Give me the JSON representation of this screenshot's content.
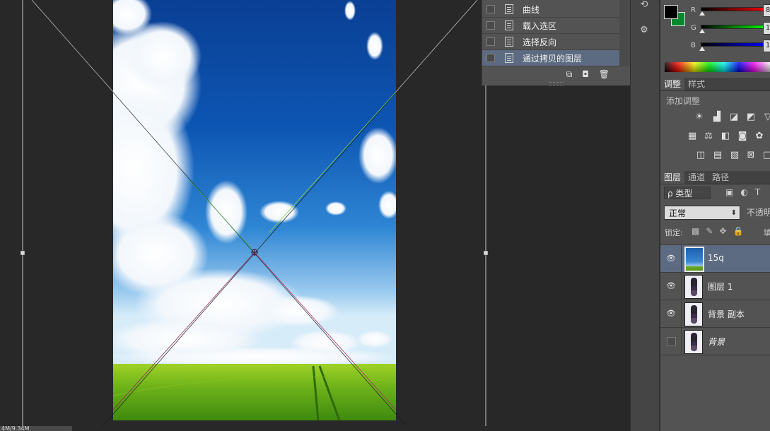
{
  "status_bar": {
    "doc_size": "4M/9.34M"
  },
  "history": {
    "items": [
      {
        "label": "曲线",
        "active": false
      },
      {
        "label": "载入选区",
        "active": false
      },
      {
        "label": "选择反向",
        "active": false
      },
      {
        "label": "通过拷贝的图层",
        "active": true
      }
    ],
    "bottom_icons": [
      "new-snapshot-icon",
      "camera-icon",
      "trash-icon"
    ]
  },
  "iconbar": {
    "buttons": [
      "history-panel-icon",
      "properties-panel-icon",
      "collapse-icon"
    ]
  },
  "color_panel": {
    "foreground": "#000000",
    "background": "#008a2d",
    "channels": [
      {
        "label": "R",
        "value": "8"
      },
      {
        "label": "G",
        "value": "1"
      },
      {
        "label": "B",
        "value": "1"
      }
    ]
  },
  "adjustments": {
    "tabs": [
      "调整",
      "样式"
    ],
    "title": "添加调整"
  },
  "layers_panel": {
    "tabs": [
      "图层",
      "通道",
      "路径"
    ],
    "filter_label": "ρ 类型",
    "blend_mode": "正常",
    "opacity_label": "不透明",
    "lock_label": "锁定:",
    "fill_label": "填",
    "layers": [
      {
        "name": "15q",
        "visible": true,
        "selected": true,
        "thumb": "sky"
      },
      {
        "name": "图层 1",
        "visible": true,
        "selected": false,
        "thumb": "person"
      },
      {
        "name": "背景 副本",
        "visible": true,
        "selected": false,
        "thumb": "person"
      },
      {
        "name": "背景",
        "visible": false,
        "selected": false,
        "thumb": "person",
        "italic": true
      }
    ]
  },
  "colors": {
    "accent_selected": "#5c6b81",
    "panel_bg": "#535353",
    "canvas_bg": "#282828"
  }
}
